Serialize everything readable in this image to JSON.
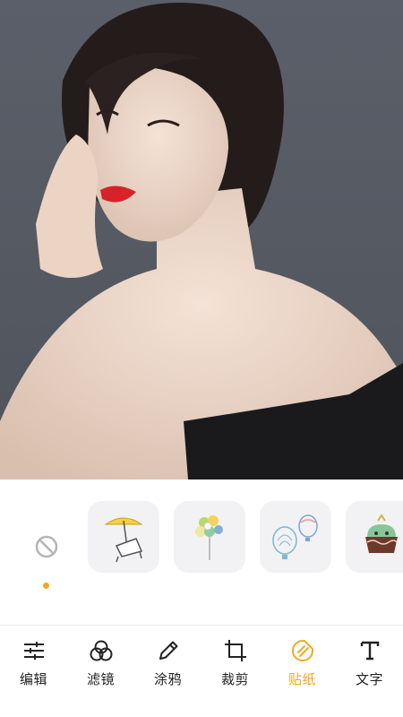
{
  "toolbar": {
    "items": [
      {
        "label": "编辑",
        "icon": "sliders-icon",
        "active": false
      },
      {
        "label": "滤镜",
        "icon": "filter-circles-icon",
        "active": false
      },
      {
        "label": "涂鸦",
        "icon": "pencil-icon",
        "active": false
      },
      {
        "label": "裁剪",
        "icon": "crop-icon",
        "active": false
      },
      {
        "label": "贴纸",
        "icon": "sticker-icon",
        "active": true
      },
      {
        "label": "文字",
        "icon": "text-icon",
        "active": false
      }
    ]
  },
  "stickers": [
    {
      "name": "no-sticker",
      "icon": "no-entry-icon",
      "selected": true
    },
    {
      "name": "beach-chair-umbrella",
      "icon": "beach-chair-icon"
    },
    {
      "name": "balloon-bouquet",
      "icon": "balloons-icon"
    },
    {
      "name": "hot-air-balloons",
      "icon": "hot-air-balloon-icon"
    },
    {
      "name": "cupcake",
      "icon": "cupcake-icon"
    }
  ],
  "colors": {
    "accent": "#f5a623",
    "tile_bg": "#f2f2f4",
    "photo_bg": "#575b64"
  }
}
